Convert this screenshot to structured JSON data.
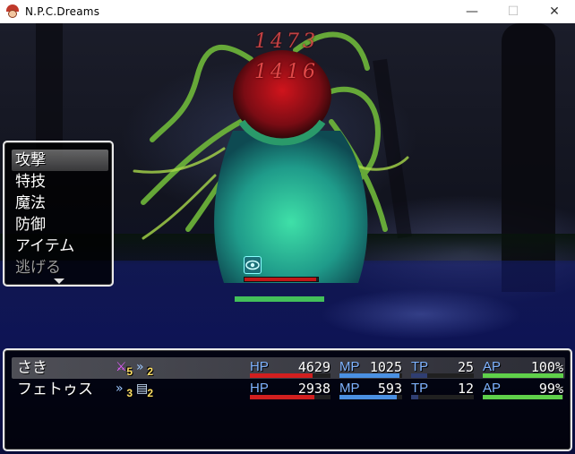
{
  "window": {
    "title": "N.P.C.Dreams",
    "minimize": "—",
    "maximize": "☐",
    "close": "✕"
  },
  "enemy": {
    "damage_popups": [
      "1473",
      "1416"
    ],
    "state_icon": "eye-icon",
    "hp_rate": 0.97,
    "sub_gauge_rate": 1.0
  },
  "commands": {
    "items": [
      {
        "label": "攻撃",
        "enabled": true,
        "selected": true
      },
      {
        "label": "特技",
        "enabled": true,
        "selected": false
      },
      {
        "label": "魔法",
        "enabled": true,
        "selected": false
      },
      {
        "label": "防御",
        "enabled": true,
        "selected": false
      },
      {
        "label": "アイテム",
        "enabled": true,
        "selected": false
      },
      {
        "label": "逃げる",
        "enabled": false,
        "selected": false
      }
    ],
    "more_indicator": "down-arrow-icon"
  },
  "gauge_labels": {
    "hp": "HP",
    "mp": "MP",
    "tp": "TP",
    "ap": "AP"
  },
  "colors": {
    "hp": "#d11f1f",
    "mp": "#4a90e2",
    "tp": "#2f3e72",
    "ap": "#5fd04a",
    "label": "#7fb3ff"
  },
  "party": [
    {
      "name": "さき",
      "selected": true,
      "states": [
        {
          "icon": "sword-buff-icon",
          "turns": "5"
        },
        {
          "icon": "speed-buff-icon",
          "turns": "2"
        }
      ],
      "hp": "4629",
      "hp_rate": 0.78,
      "mp": "1025",
      "mp_rate": 0.95,
      "tp": "25",
      "tp_rate": 0.25,
      "ap": "100%",
      "ap_rate": 1.0
    },
    {
      "name": "フェトゥス",
      "selected": false,
      "states": [
        {
          "icon": "speed-buff-icon",
          "turns": "3"
        },
        {
          "icon": "book-icon",
          "turns": "2"
        }
      ],
      "hp": "2938",
      "hp_rate": 0.8,
      "mp": "593",
      "mp_rate": 0.92,
      "tp": "12",
      "tp_rate": 0.12,
      "ap": "99%",
      "ap_rate": 0.99
    }
  ]
}
